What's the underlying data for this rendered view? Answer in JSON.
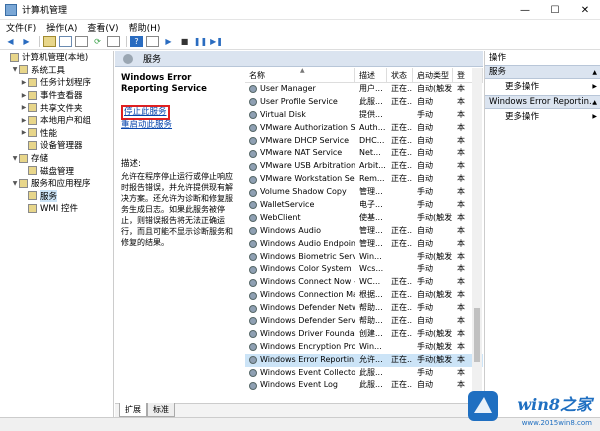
{
  "window": {
    "title": "计算机管理",
    "controls": [
      "—",
      "☐",
      "✕"
    ]
  },
  "menu": [
    "文件(F)",
    "操作(A)",
    "查看(V)",
    "帮助(H)"
  ],
  "tree": [
    {
      "label": "计算机管理(本地)",
      "indent": 0,
      "expander": ""
    },
    {
      "label": "系统工具",
      "indent": 1,
      "expander": "▼"
    },
    {
      "label": "任务计划程序",
      "indent": 2,
      "expander": "▶"
    },
    {
      "label": "事件查看器",
      "indent": 2,
      "expander": "▶"
    },
    {
      "label": "共享文件夹",
      "indent": 2,
      "expander": "▶"
    },
    {
      "label": "本地用户和组",
      "indent": 2,
      "expander": "▶"
    },
    {
      "label": "性能",
      "indent": 2,
      "expander": "▶"
    },
    {
      "label": "设备管理器",
      "indent": 2,
      "expander": ""
    },
    {
      "label": "存储",
      "indent": 1,
      "expander": "▼"
    },
    {
      "label": "磁盘管理",
      "indent": 2,
      "expander": ""
    },
    {
      "label": "服务和应用程序",
      "indent": 1,
      "expander": "▼"
    },
    {
      "label": "服务",
      "indent": 2,
      "expander": "",
      "selected": true
    },
    {
      "label": "WMI 控件",
      "indent": 2,
      "expander": ""
    }
  ],
  "center": {
    "header": "服务",
    "service_title": "Windows Error Reporting Service",
    "links": [
      "停止此服务",
      "重启动此服务"
    ],
    "description_label": "描述:",
    "description": "允许在程序停止运行或停止响应时报告错误，并允许提供现有解决方案。还允许为诊断和修复服务生成日志。如果此服务被停止，则错误报告将无法正确运行，而且可能不显示诊断服务和修复的结果。",
    "columns": [
      "名称",
      "描述",
      "状态",
      "启动类型",
      "登"
    ],
    "rows": [
      [
        "User Manager",
        "用户...",
        "正在...",
        "自动(触发...",
        "本"
      ],
      [
        "User Profile Service",
        "此服...",
        "正在...",
        "自动",
        "本"
      ],
      [
        "Virtual Disk",
        "提供...",
        "",
        "手动",
        "本"
      ],
      [
        "VMware Authorization Se...",
        "Auth...",
        "正在...",
        "自动",
        "本"
      ],
      [
        "VMware DHCP Service",
        "DHC...",
        "正在...",
        "自动",
        "本"
      ],
      [
        "VMware NAT Service",
        "Net...",
        "正在...",
        "自动",
        "本"
      ],
      [
        "VMware USB Arbitration ...",
        "Arbit...",
        "正在...",
        "自动",
        "本"
      ],
      [
        "VMware Workstation Ser...",
        "Rem...",
        "正在...",
        "自动",
        "本"
      ],
      [
        "Volume Shadow Copy",
        "管理...",
        "",
        "手动",
        "本"
      ],
      [
        "WalletService",
        "电子...",
        "",
        "手动",
        "本"
      ],
      [
        "WebClient",
        "使基...",
        "",
        "手动(触发...",
        "本"
      ],
      [
        "Windows Audio",
        "管理...",
        "正在...",
        "自动",
        "本"
      ],
      [
        "Windows Audio Endpoint...",
        "管理...",
        "正在...",
        "自动",
        "本"
      ],
      [
        "Windows Biometric Servic...",
        "Win...",
        "",
        "手动(触发...",
        "本"
      ],
      [
        "Windows Color System",
        "Wcs...",
        "",
        "手动",
        "本"
      ],
      [
        "Windows Connect Now - ...",
        "WC...",
        "正在...",
        "手动",
        "本"
      ],
      [
        "Windows Connection Ma...",
        "根据...",
        "正在...",
        "自动(触发...",
        "本"
      ],
      [
        "Windows Defender Netw...",
        "帮助...",
        "正在...",
        "手动",
        "本"
      ],
      [
        "Windows Defender Service",
        "帮助...",
        "正在...",
        "自动",
        "本"
      ],
      [
        "Windows Driver Foundati...",
        "创建...",
        "正在...",
        "手动(触发...",
        "本"
      ],
      [
        "Windows Encryption Pro...",
        "Win...",
        "",
        "手动(触发...",
        "本"
      ],
      [
        "Windows Error Reportin...",
        "允许...",
        "正在...",
        "手动(触发...",
        "本"
      ],
      [
        "Windows Event Collector",
        "此服...",
        "",
        "手动",
        "本"
      ],
      [
        "Windows Event Log",
        "此服...",
        "正在...",
        "自动",
        "本"
      ]
    ],
    "selected_row": 21,
    "tabs": [
      "扩展",
      "标准"
    ]
  },
  "actions": {
    "title": "操作",
    "sections": [
      {
        "label": "服务",
        "more": "更多操作"
      },
      {
        "label": "Windows Error Reportin...",
        "more": "更多操作"
      }
    ]
  },
  "watermark": {
    "text": "win8之家",
    "url": "www.2015win8.com"
  }
}
